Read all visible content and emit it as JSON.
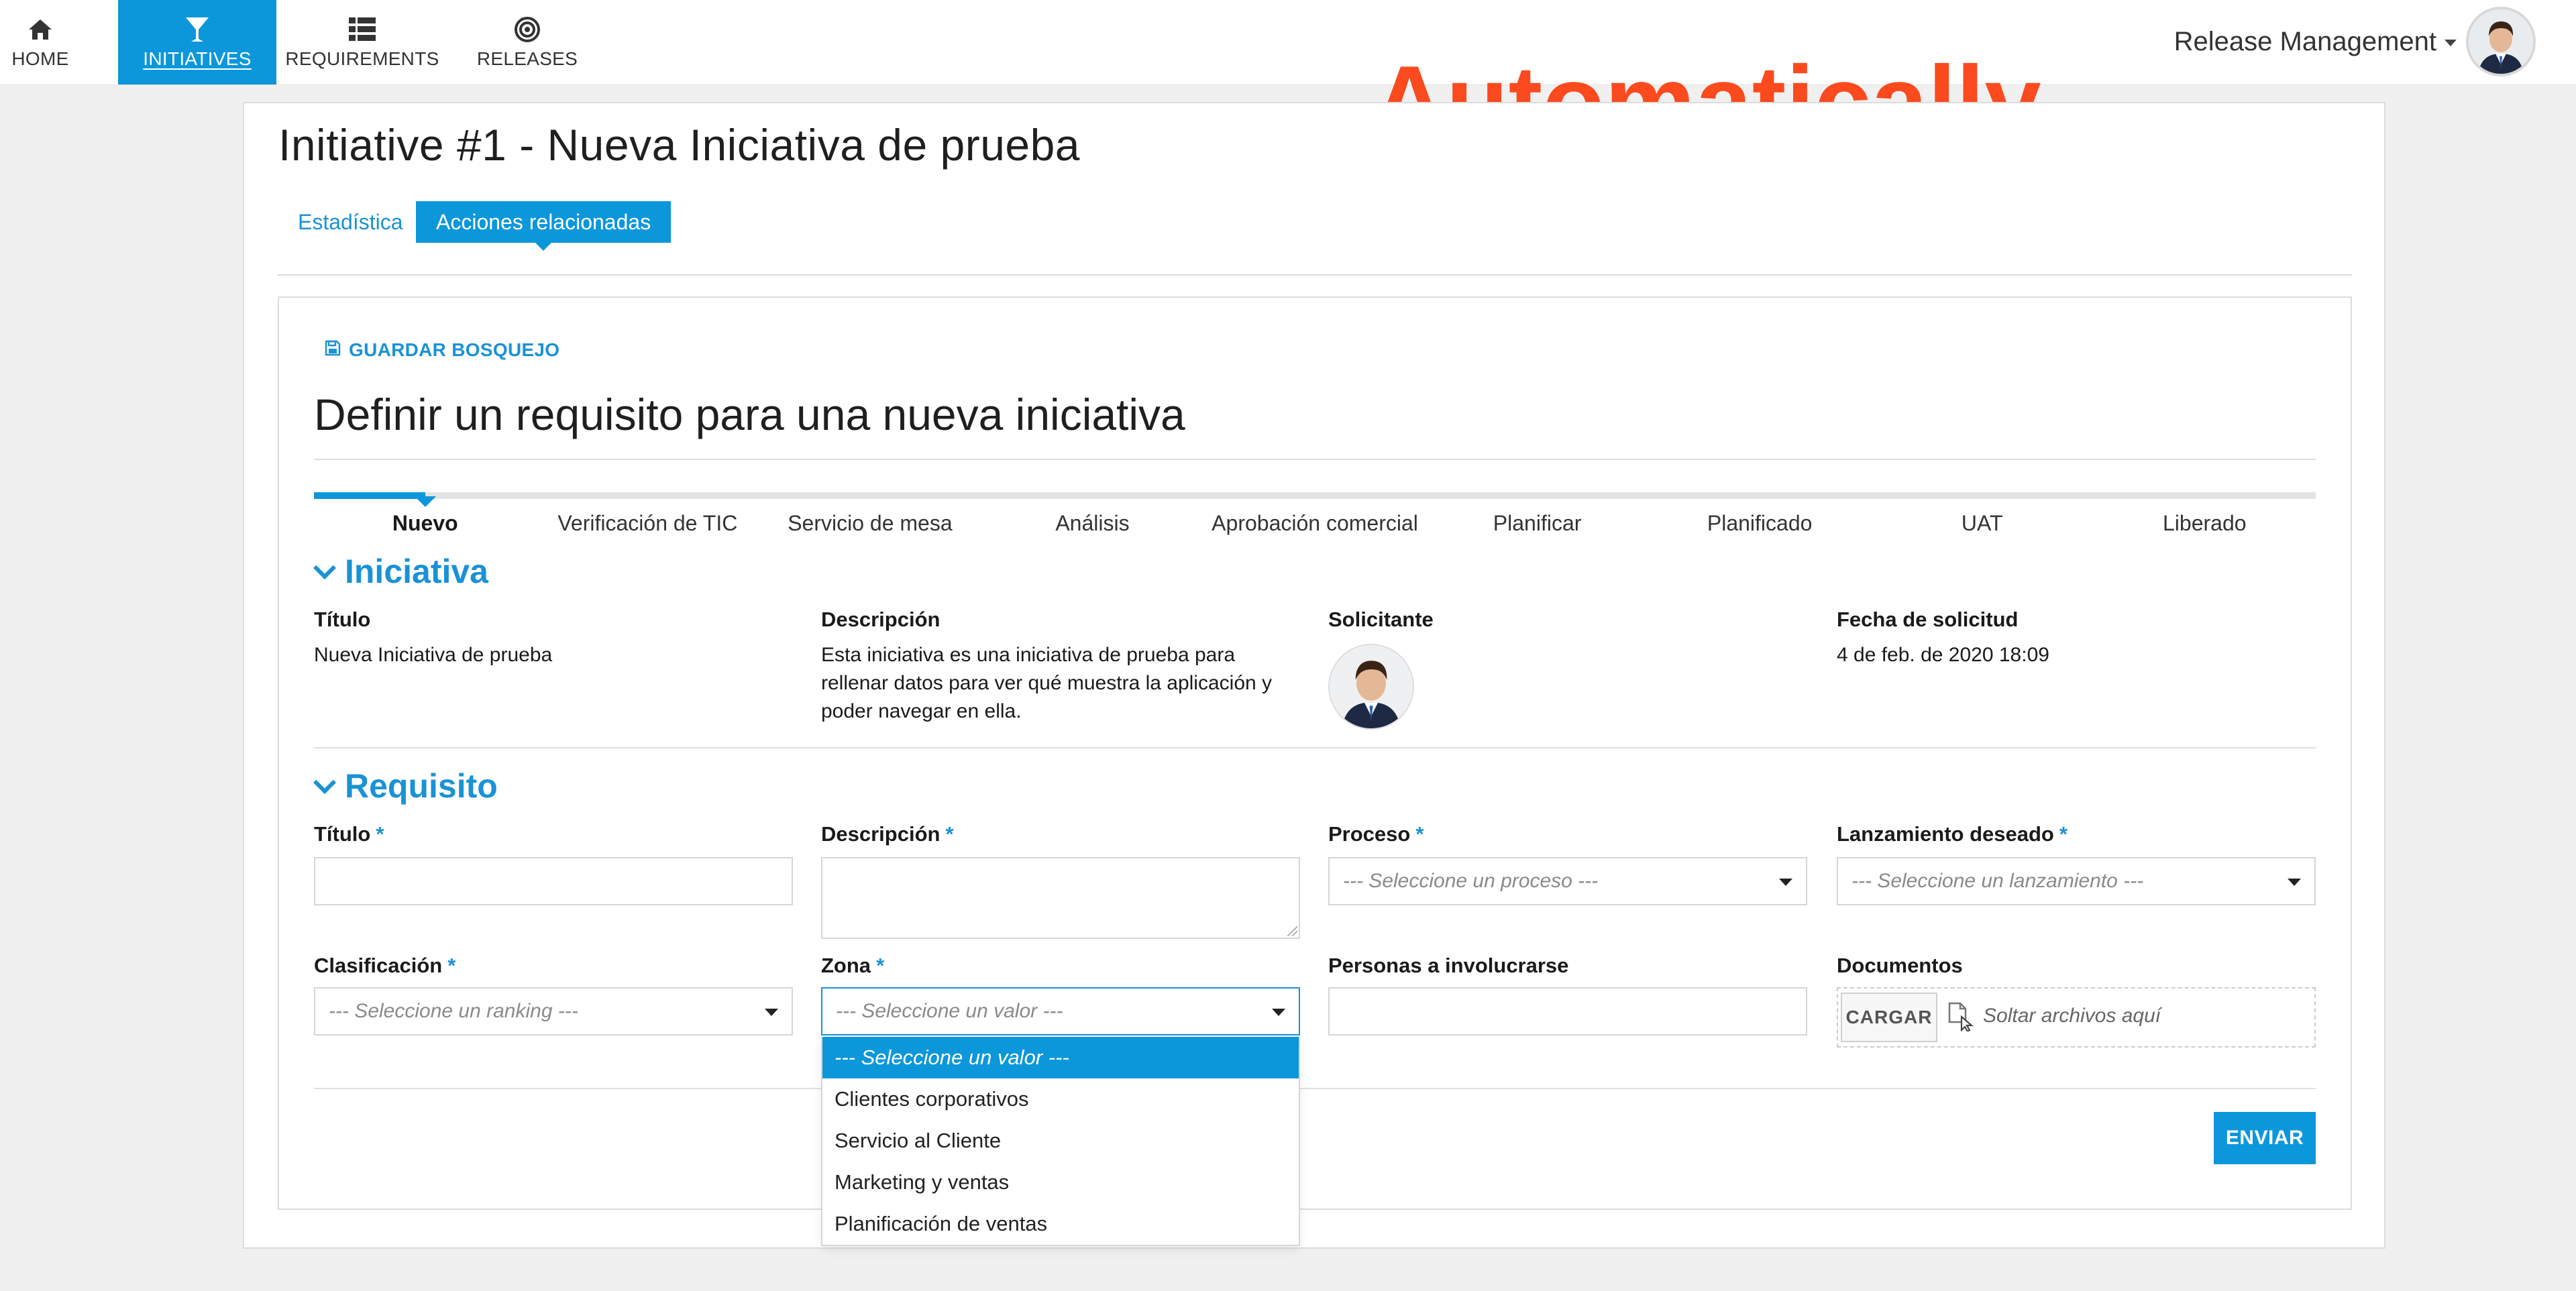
{
  "nav": {
    "items": [
      {
        "label": "HOME",
        "icon": "home-icon"
      },
      {
        "label": "INITIATIVES",
        "icon": "funnel-icon",
        "active": true
      },
      {
        "label": "REQUIREMENTS",
        "icon": "list-icon"
      },
      {
        "label": "RELEASES",
        "icon": "target-icon"
      }
    ],
    "user_menu_label": "Release Management"
  },
  "overlay": {
    "text": "Automatically\nTranslated",
    "color": "#fb4a1e"
  },
  "page": {
    "title": "Initiative #1 - Nueva Iniciativa de prueba",
    "tabs": [
      {
        "label": "Estadística",
        "active": false
      },
      {
        "label": "Acciones relacionadas",
        "active": true
      }
    ]
  },
  "form": {
    "save_draft_label": "GUARDAR BOSQUEJO",
    "title": "Definir un requisito para una nueva iniciativa",
    "steps": [
      "Nuevo",
      "Verificación de TIC",
      "Servicio de mesa",
      "Análisis",
      "Aprobación comercial",
      "Planificar",
      "Planificado",
      "UAT",
      "Liberado"
    ],
    "current_step": "Nuevo",
    "initiative": {
      "heading": "Iniciativa",
      "title_label": "Título",
      "title_value": "Nueva Iniciativa de prueba",
      "description_label": "Descripción",
      "description_value": "Esta iniciativa es una iniciativa de prueba para rellenar datos para ver qué muestra la aplicación y poder navegar en ella.",
      "requester_label": "Solicitante",
      "request_date_label": "Fecha de solicitud",
      "request_date_value": "4 de feb. de 2020 18:09"
    },
    "requirement": {
      "heading": "Requisito",
      "required_mark": "*",
      "title_label": "Título",
      "title_value": "",
      "description_label": "Descripción",
      "description_value": "",
      "process_label": "Proceso",
      "process_placeholder": "--- Seleccione un proceso ---",
      "release_label": "Lanzamiento deseado",
      "release_placeholder": "--- Seleccione un lanzamiento ---",
      "ranking_label": "Clasificación",
      "ranking_placeholder": "--- Seleccione un ranking ---",
      "zone_label": "Zona",
      "zone_placeholder": "--- Seleccione un valor ---",
      "people_label": "Personas a involucrarse",
      "people_value": "",
      "documents_label": "Documentos",
      "upload_label": "CARGAR",
      "drop_text": "Soltar archivos aquí",
      "zone_options": [
        {
          "label": "--- Seleccione un valor ---",
          "selected": true
        },
        {
          "label": "Clientes corporativos",
          "selected": false
        },
        {
          "label": "Servicio al Cliente",
          "selected": false
        },
        {
          "label": "Marketing y ventas",
          "selected": false
        },
        {
          "label": "Planificación de ventas",
          "selected": false
        }
      ]
    },
    "submit_label": "ENVIAR"
  },
  "colors": {
    "accent": "#0d97db",
    "link": "#1a92d6"
  }
}
